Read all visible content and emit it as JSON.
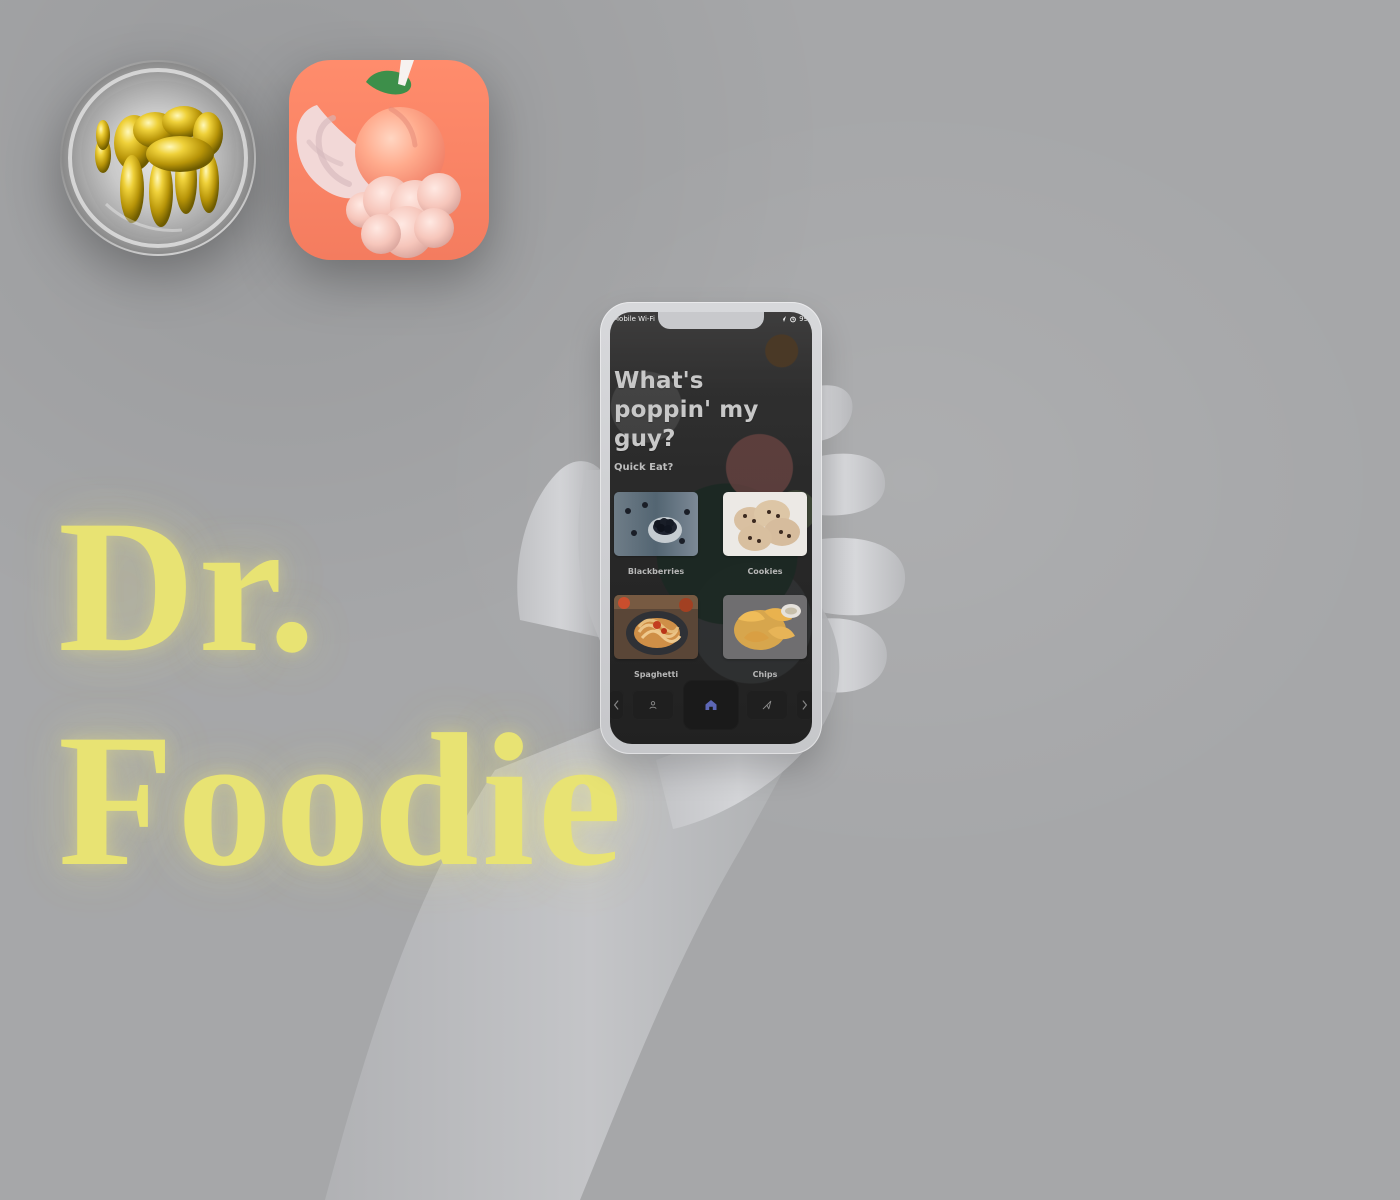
{
  "colors": {
    "background": "#a6a7a9",
    "titleGlow": "#e8e373",
    "peachIconBg": "#f47c5f",
    "phoneFrame": "#c6c7ca",
    "screenDark": "#2b2b2b",
    "homeAccent": "#5d67b6"
  },
  "brand": {
    "title_line_1": "Dr.",
    "title_line_2": "Foodie"
  },
  "appIcons": [
    {
      "name": "balloon-dog-app-icon"
    },
    {
      "name": "winged-peach-app-icon"
    }
  ],
  "phone": {
    "status": {
      "left": "Mobile Wi-Fi",
      "right": "99"
    },
    "headline": "What's poppin' my guy?",
    "section_label": "Quick Eat?",
    "items": [
      {
        "label": "Blackberries",
        "image": "blackberries-image"
      },
      {
        "label": "Cookies",
        "image": "cookies-image"
      },
      {
        "label": "Spaghetti",
        "image": "spaghetti-image"
      },
      {
        "label": "Chips",
        "image": "chips-image"
      }
    ],
    "nav": [
      {
        "icon": "profile-icon"
      },
      {
        "icon": "home-icon",
        "active": true
      },
      {
        "icon": "send-icon"
      }
    ]
  }
}
